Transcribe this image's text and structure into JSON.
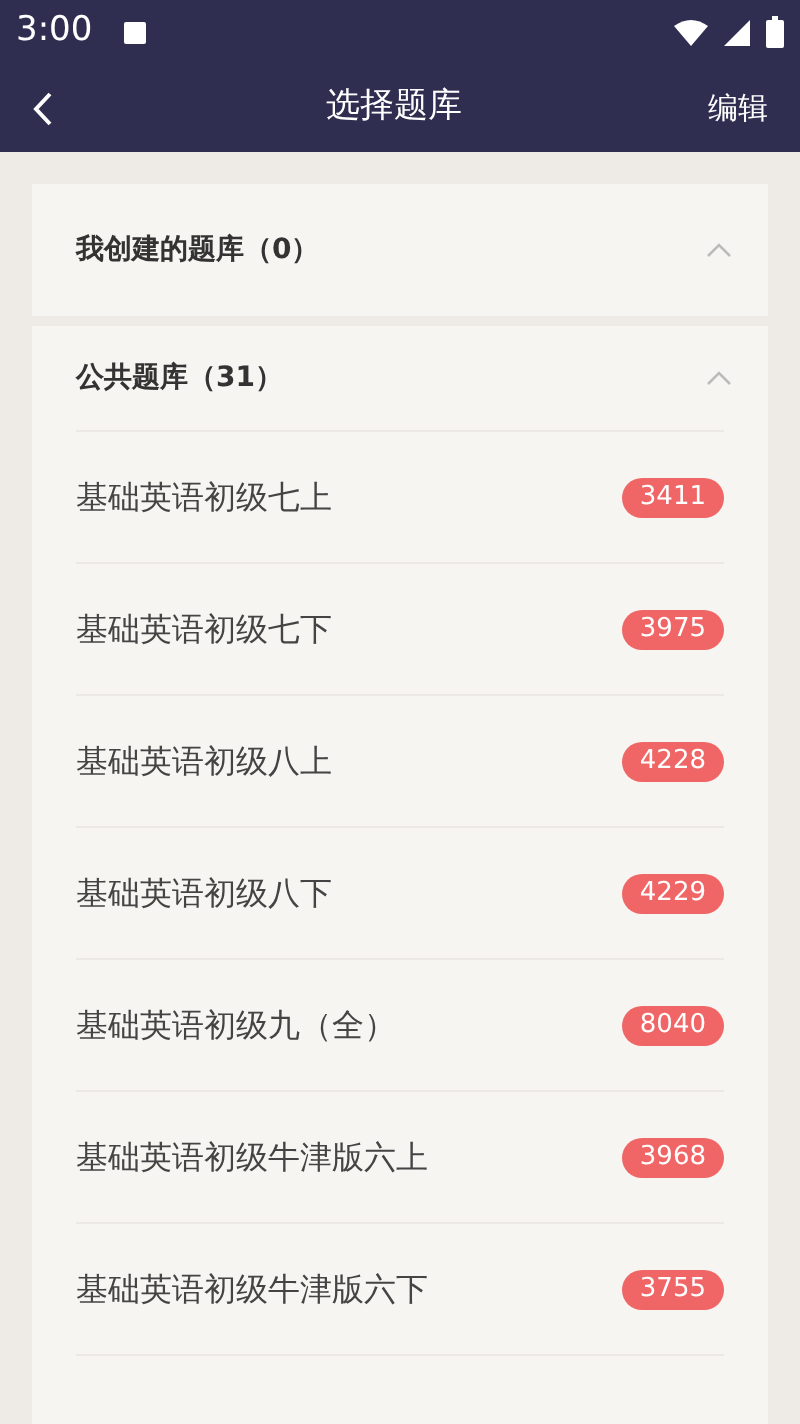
{
  "status_bar": {
    "time": "3:00"
  },
  "header": {
    "title": "选择题库",
    "action": "编辑"
  },
  "sections": [
    {
      "title": "我创建的题库（0）",
      "expanded": true
    },
    {
      "title": "公共题库（31）",
      "expanded": true,
      "items": [
        {
          "name": "基础英语初级七上",
          "count": "3411"
        },
        {
          "name": "基础英语初级七下",
          "count": "3975"
        },
        {
          "name": "基础英语初级八上",
          "count": "4228"
        },
        {
          "name": "基础英语初级八下",
          "count": "4229"
        },
        {
          "name": "基础英语初级九（全）",
          "count": "8040"
        },
        {
          "name": "基础英语初级牛津版六上",
          "count": "3968"
        },
        {
          "name": "基础英语初级牛津版六下",
          "count": "3755"
        }
      ]
    }
  ]
}
